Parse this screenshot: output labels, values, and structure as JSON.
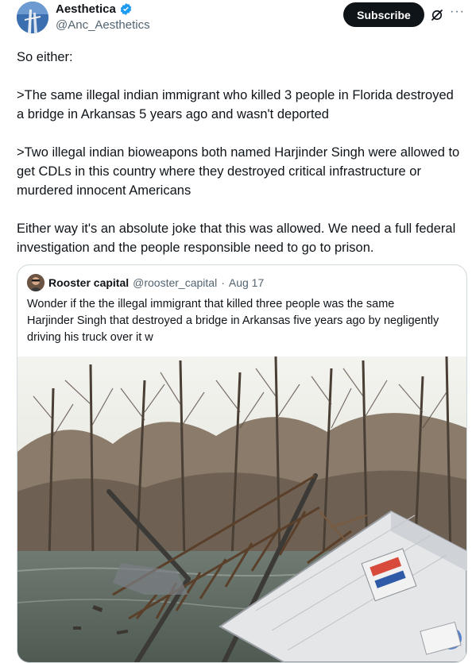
{
  "author": {
    "display_name": "Aesthetica",
    "handle": "@Anc_Aesthetics"
  },
  "actions": {
    "subscribe_label": "Subscribe",
    "more_label": "···"
  },
  "tweet": {
    "text": "So either:\n\n>The same illegal indian immigrant who killed 3 people in Florida destroyed a bridge in Arkansas 5 years ago and wasn't deported\n\n>Two illegal indian bioweapons both named Harjinder Singh were allowed to get CDLs in this country where they destroyed critical infrastructure or murdered innocent Americans\n\nEither way it's an absolute joke that this was allowed. We need a full federal investigation and the people responsible need to go to prison."
  },
  "quoted": {
    "display_name": "Rooster capital",
    "handle": "@rooster_capital",
    "separator": "·",
    "date": "Aug 17",
    "text": "Wonder if the the illegal immigrant that killed three people was the same Harjinder Singh that destroyed a bridge in Arkansas five years ago by negligently driving his truck over it w"
  },
  "colors": {
    "text_primary": "#0f1419",
    "text_secondary": "#536471",
    "verified_blue": "#1d9bf0",
    "border": "#cfd9de",
    "button_dark": "#0f1419"
  },
  "icons": [
    "verified-badge-icon",
    "grok-icon",
    "more-icon"
  ]
}
